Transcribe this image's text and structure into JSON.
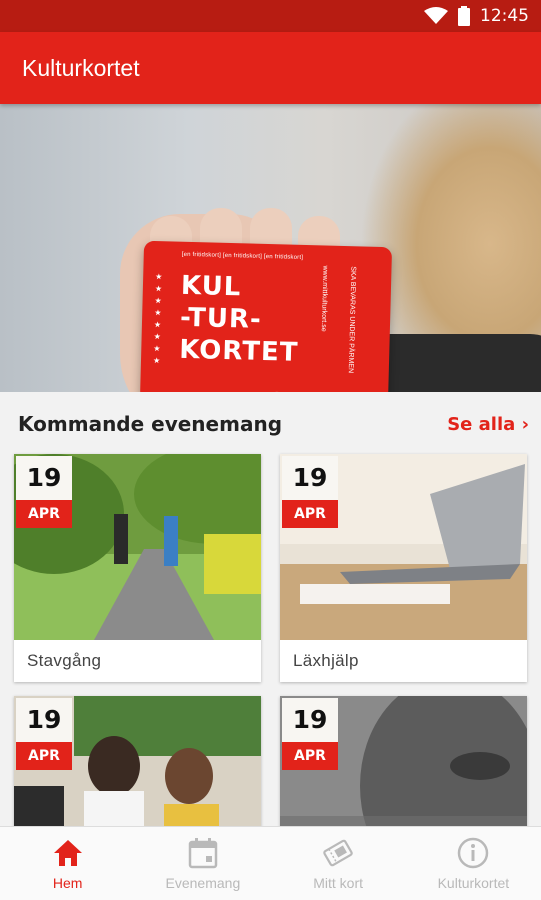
{
  "status_bar": {
    "time": "12:45"
  },
  "app_bar": {
    "title": "Kulturkortet"
  },
  "hero": {
    "card_top_text": "[en fritidskort] [en fritidskort] [en fritidskort]",
    "card_big_lines": [
      "KUL",
      "-TUR-",
      "KORTET"
    ],
    "card_url": "www.mittkulturkort.se",
    "card_side_text": "SKA BEVARAS UNDER PÄRMEN"
  },
  "events": {
    "title": "Kommande evenemang",
    "see_all": "Se alla",
    "items": [
      {
        "day": "19",
        "month": "APR",
        "label": "Stavgång"
      },
      {
        "day": "19",
        "month": "APR",
        "label": "Läxhjälp"
      },
      {
        "day": "19",
        "month": "APR",
        "label": ""
      },
      {
        "day": "19",
        "month": "APR",
        "label": ""
      }
    ]
  },
  "bottom_nav": {
    "items": [
      {
        "label": "Hem",
        "icon": "home-icon",
        "active": true
      },
      {
        "label": "Evenemang",
        "icon": "calendar-icon",
        "active": false
      },
      {
        "label": "Mitt kort",
        "icon": "ticket-icon",
        "active": false
      },
      {
        "label": "Kulturkortet",
        "icon": "info-icon",
        "active": false
      }
    ]
  },
  "colors": {
    "primary": "#e2231a",
    "status_bar": "#b71c12",
    "inactive": "#b9b9b9"
  }
}
